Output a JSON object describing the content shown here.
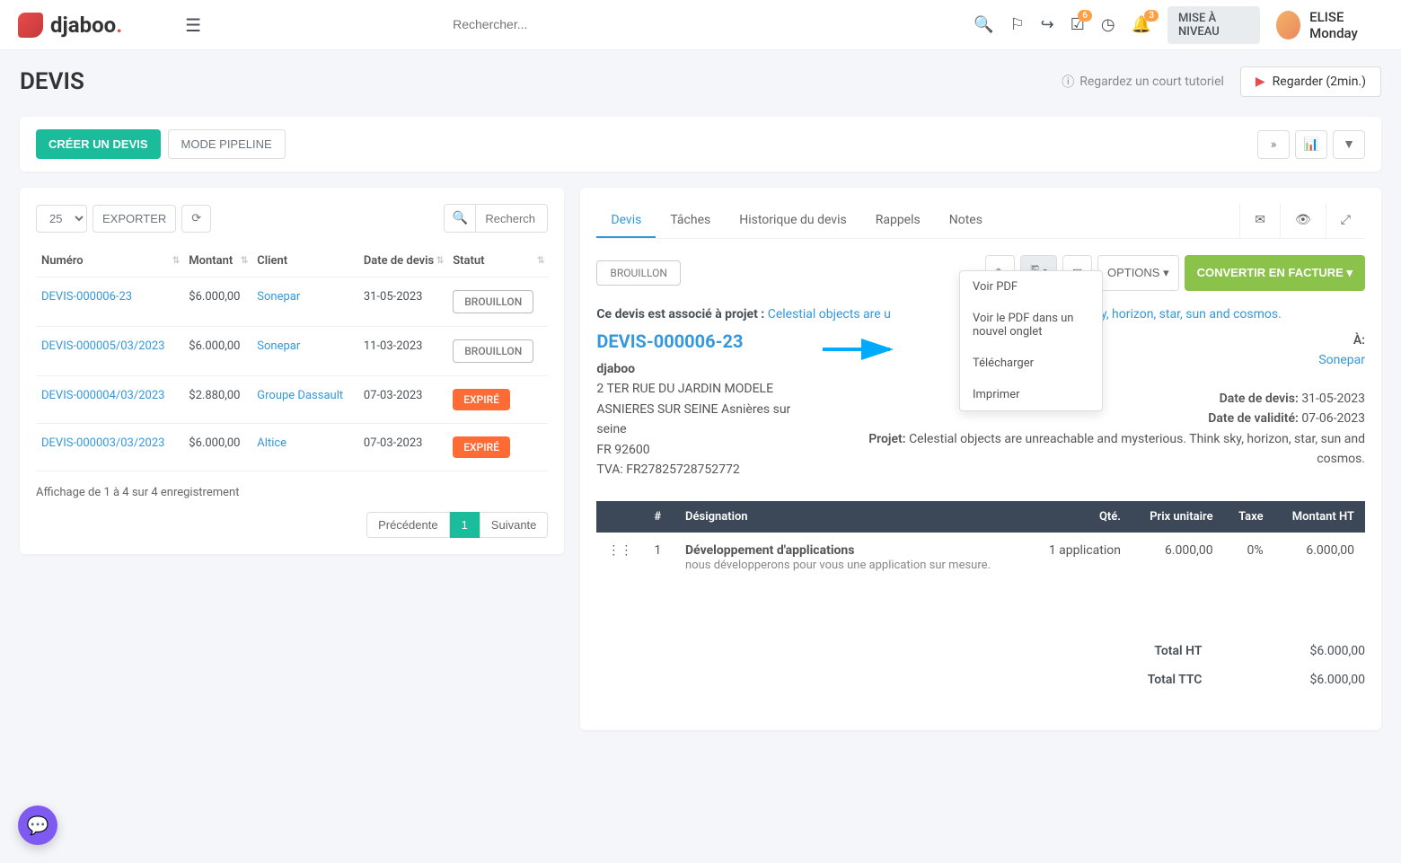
{
  "brand": "djaboo",
  "header": {
    "search_placeholder": "Rechercher...",
    "badge_tasks": "6",
    "badge_notif": "3",
    "upgrade_label": "MISE À NIVEAU",
    "user_name": "ELISE Monday"
  },
  "page": {
    "title": "DEVIS",
    "tutorial_label": "Regardez un court tutoriel",
    "watch_label": "Regarder (2min.)",
    "create_btn": "CRÉER UN DEVIS",
    "pipeline_btn": "MODE PIPELINE"
  },
  "table": {
    "page_size": "25",
    "export_btn": "EXPORTER",
    "search_placeholder": "Recherch",
    "columns": {
      "numero": "Numéro",
      "montant": "Montant",
      "client": "Client",
      "date": "Date de devis",
      "statut": "Statut"
    },
    "rows": [
      {
        "numero": "DEVIS-000006-23",
        "montant": "$6.000,00",
        "client": "Sonepar",
        "date": "31-05-2023",
        "statut": "BROUILLON",
        "statut_type": "brouillon"
      },
      {
        "numero": "DEVIS-000005/03/2023",
        "montant": "$6.000,00",
        "client": "Sonepar",
        "date": "11-03-2023",
        "statut": "BROUILLON",
        "statut_type": "brouillon"
      },
      {
        "numero": "DEVIS-000004/03/2023",
        "montant": "$2.880,00",
        "client": "Groupe Dassault",
        "date": "07-03-2023",
        "statut": "EXPIRÉ",
        "statut_type": "expire"
      },
      {
        "numero": "DEVIS-000003/03/2023",
        "montant": "$6.000,00",
        "client": "Altice",
        "date": "07-03-2023",
        "statut": "EXPIRÉ",
        "statut_type": "expire"
      }
    ],
    "footer": "Affichage de 1 à 4 sur 4 enregistrement",
    "prev": "Précédente",
    "page_num": "1",
    "next": "Suivante"
  },
  "detail": {
    "tabs": [
      "Devis",
      "Tâches",
      "Historique du devis",
      "Rappels",
      "Notes"
    ],
    "draft_label": "BROUILLON",
    "options_label": "OPTIONS",
    "convert_label": "CONVERTIR EN FACTURE",
    "project_prefix": "Ce devis est associé à projet :",
    "project_link": "Celestial objects are u",
    "project_suffix": "ous. Think sky, horizon, star, sun and cosmos.",
    "devis_number": "DEVIS-000006-23",
    "company": {
      "name": "djaboo",
      "addr1": "2 TER RUE DU JARDIN MODELE",
      "addr2": "ASNIERES SUR SEINE Asnières sur seine",
      "addr3": "FR 92600",
      "vat": "TVA: FR27825728752772"
    },
    "meta": {
      "to_label": "À:",
      "client": "Sonepar",
      "date_label": "Date de devis:",
      "date_value": "31-05-2023",
      "validity_label": "Date de validité:",
      "validity_value": "07-06-2023",
      "project_label": "Projet:",
      "project_value": "Celestial objects are unreachable and mysterious. Think sky, horizon, star, sun and cosmos."
    },
    "items_header": {
      "num": "#",
      "desig": "Désignation",
      "qte": "Qté.",
      "prix": "Prix unitaire",
      "taxe": "Taxe",
      "montant": "Montant HT"
    },
    "items": [
      {
        "num": "1",
        "title": "Développement d'applications",
        "desc": "nous développerons pour vous une application sur mesure.",
        "qte": "1 application",
        "prix": "6.000,00",
        "taxe": "0%",
        "montant": "6.000,00"
      }
    ],
    "totals": {
      "ht_label": "Total HT",
      "ht_value": "$6.000,00",
      "ttc_label": "Total TTC",
      "ttc_value": "$6.000,00"
    }
  },
  "dropdown": {
    "items": [
      "Voir PDF",
      "Voir le PDF dans un nouvel onglet",
      "Télécharger",
      "Imprimer"
    ]
  }
}
